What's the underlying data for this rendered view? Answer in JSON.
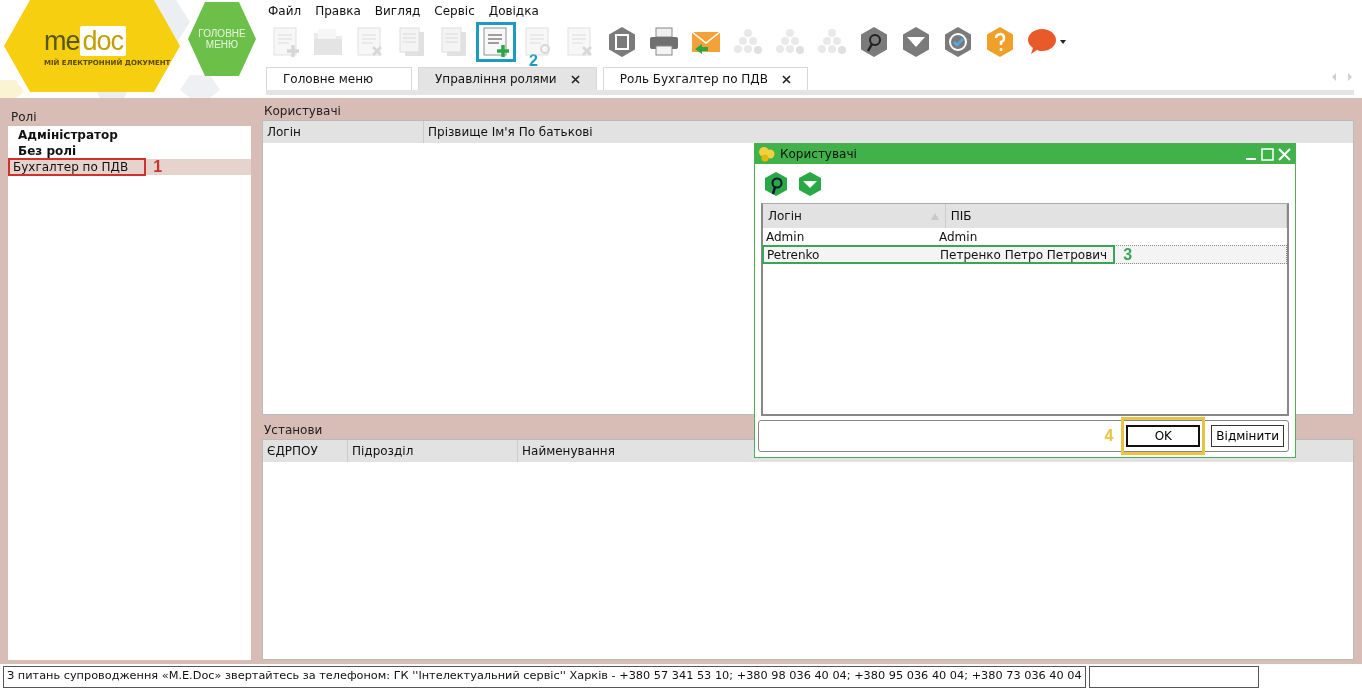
{
  "logo": {
    "brand_a": "me",
    "brand_b": "doc",
    "tagline": "МІЙ ЕЛЕКТРОННИЙ ДОКУМЕНТ"
  },
  "main_menu_button": {
    "line1": "ГОЛОВНЕ",
    "line2": "МЕНЮ"
  },
  "menu": [
    "Файл",
    "Правка",
    "Вигляд",
    "Сервіс",
    "Довідка"
  ],
  "toolbar": [
    {
      "kind": "doc-add",
      "disabled": true
    },
    {
      "kind": "folder",
      "disabled": true
    },
    {
      "kind": "doc-delete",
      "disabled": true
    },
    {
      "kind": "copy",
      "disabled": true
    },
    {
      "kind": "copy",
      "disabled": true
    },
    {
      "kind": "list-add",
      "disabled": false
    },
    {
      "kind": "list-edit",
      "disabled": true
    },
    {
      "kind": "list-delete",
      "disabled": true
    },
    {
      "kind": "hex-save",
      "disabled": false
    },
    {
      "kind": "printer",
      "disabled": false
    },
    {
      "kind": "envelope",
      "disabled": false
    },
    {
      "kind": "cluster",
      "disabled": true
    },
    {
      "kind": "cluster",
      "disabled": true
    },
    {
      "kind": "cluster",
      "disabled": true
    },
    {
      "kind": "hex-search",
      "disabled": false
    },
    {
      "kind": "hex-filter",
      "disabled": false
    },
    {
      "kind": "hex-check",
      "disabled": false
    },
    {
      "kind": "hex-help",
      "disabled": false
    },
    {
      "kind": "chat",
      "disabled": false
    }
  ],
  "tabs": [
    {
      "label": "Головне меню",
      "selected": false,
      "closable": false
    },
    {
      "label": "Управління ролями",
      "selected": true,
      "closable": true
    },
    {
      "label": "Роль Бухгалтер по ПДВ",
      "selected": false,
      "closable": true
    }
  ],
  "roles": {
    "title": "Ролі",
    "items": [
      {
        "label": "Адміністратор",
        "bold": true,
        "selected": false
      },
      {
        "label": "Без ролі",
        "bold": true,
        "selected": false
      },
      {
        "label": "Бухгалтер по ПДВ",
        "bold": false,
        "selected": true
      }
    ]
  },
  "users_panel": {
    "title": "Користувачі",
    "columns": [
      "Логін",
      "Прізвище Ім'я По батькові"
    ]
  },
  "establishments_panel": {
    "title": "Установи",
    "columns": [
      "ЄДРПОУ",
      "Підрозділ",
      "Найменування"
    ]
  },
  "dialog": {
    "title": "Користувачі",
    "columns": [
      {
        "label": "Логін",
        "sorted": true
      },
      {
        "label": "ПІБ",
        "sorted": false
      }
    ],
    "rows": [
      {
        "login": "Admin",
        "name": "Admin",
        "selected": false
      },
      {
        "login": "Petrenko",
        "name": "Петренко Петро Петрович",
        "selected": true
      }
    ],
    "buttons": [
      {
        "label": "OK",
        "default": true
      },
      {
        "label": "Відмінити",
        "default": false
      }
    ]
  },
  "annotations": [
    {
      "label": "1",
      "color": "#d0312d"
    },
    {
      "label": "2",
      "color": "#1e9ac0"
    },
    {
      "label": "3",
      "color": "#3aa655"
    },
    {
      "label": "4",
      "color": "#e8c440"
    }
  ],
  "status_bar": {
    "message": "З питань супроводження «M.E.Doc» звертайтесь за телефоном: ГК ''Інтелектуальний сервіс'' Харків - +380 57 341 53 10; +380 98 036 40 04; +380 95 036 40 04; +380 73 036 40 04"
  }
}
